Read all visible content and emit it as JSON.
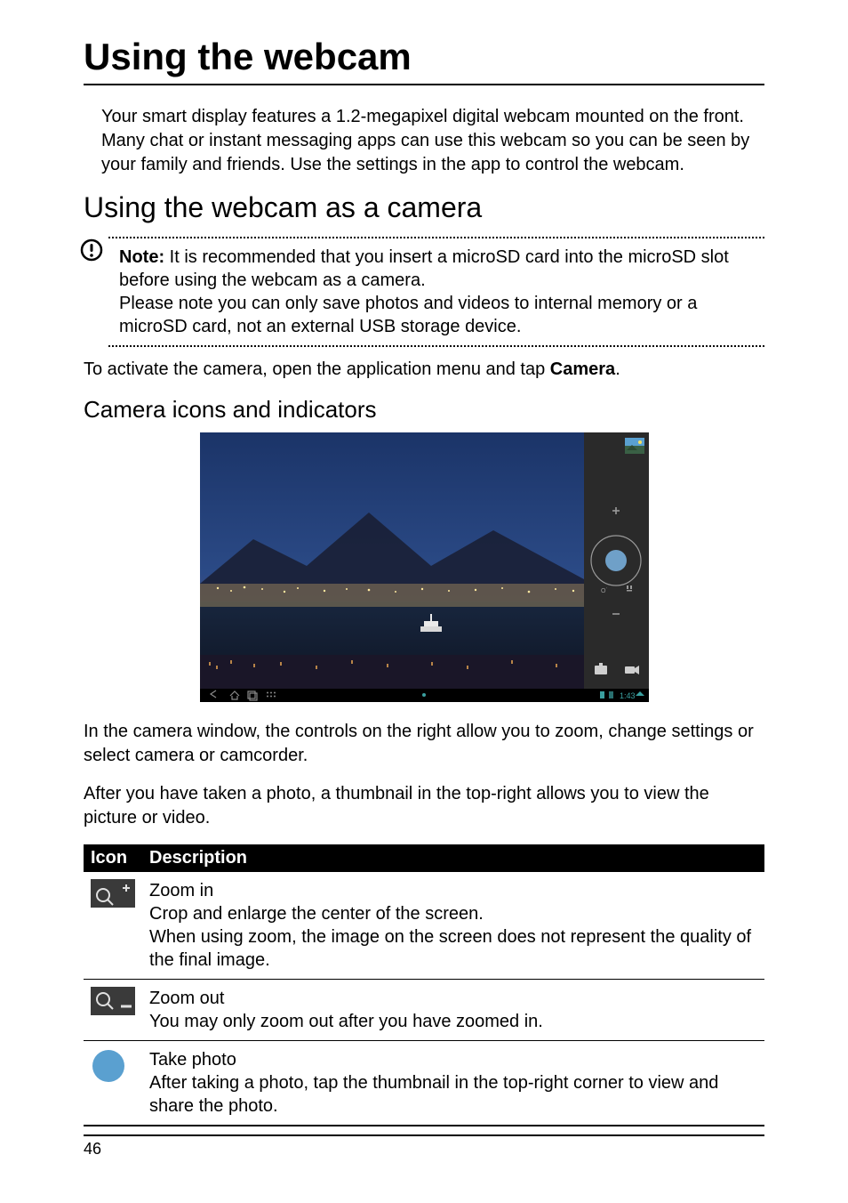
{
  "page": {
    "title": "Using the webcam",
    "intro": "Your smart display features a 1.2-megapixel digital webcam mounted on the front. Many chat or instant messaging apps can use this webcam so you can be seen by your family and friends. Use the settings in the app to control the webcam.",
    "h2": "Using the webcam as a camera",
    "note_label": "Note:",
    "note_text": " It is recommended that you insert a microSD card into the microSD slot before using the webcam as a camera.",
    "note_text2": "Please note you can only save photos and videos to internal memory or a microSD card, not an external USB storage device.",
    "activate_pre": "To activate the camera, open the application menu and tap ",
    "activate_bold": "Camera",
    "activate_post": ".",
    "h3": "Camera icons and indicators",
    "after_text1": "In the camera window, the controls on the right allow you to zoom, change settings or select camera or camcorder.",
    "after_text2": "After you have taken a photo, a thumbnail in the top-right allows you to view the picture or video.",
    "page_number": "46"
  },
  "table": {
    "headers": {
      "col1": "Icon",
      "col2": "Description"
    },
    "rows": [
      {
        "id": "zoom-in",
        "desc_title": "Zoom in",
        "desc_body": "Crop and enlarge the center of the screen.\nWhen using zoom, the image on the screen does not represent the quality of the final image."
      },
      {
        "id": "zoom-out",
        "desc_title": "Zoom out",
        "desc_body": "You may only zoom out after you have zoomed in."
      },
      {
        "id": "take-photo",
        "desc_title": "Take photo",
        "desc_body": "After taking a photo, tap the thumbnail in the top-right corner to view and share the photo."
      }
    ]
  },
  "camera_ui": {
    "status_time": "1:43",
    "icons": {
      "thumbnail": "photo-thumbnail-icon",
      "zoom_plus": "plus-icon",
      "shutter": "shutter-button-icon",
      "mode_left": "hdr-icon",
      "mode_right": "settings-icon",
      "zoom_minus": "minus-icon",
      "camera_toggle": "camera-mode-icon",
      "video_toggle": "video-mode-icon",
      "nav_back": "back-icon",
      "nav_home": "home-icon",
      "nav_recent": "recent-icon",
      "nav_apps": "apps-icon",
      "status_batt": "battery-icon",
      "status_wifi": "wifi-icon"
    }
  },
  "chart_data": {
    "type": "table",
    "title": "Camera icons and indicators",
    "columns": [
      "Icon",
      "Description"
    ],
    "rows": [
      [
        "Zoom in icon (magnifier +)",
        "Zoom in — Crop and enlarge the center of the screen. When using zoom, the image on the screen does not represent the quality of the final image."
      ],
      [
        "Zoom out icon (magnifier −)",
        "Zoom out — You may only zoom out after you have zoomed in."
      ],
      [
        "Take photo icon (blue circle)",
        "Take photo — After taking a photo, tap the thumbnail in the top-right corner to view and share the photo."
      ]
    ]
  }
}
